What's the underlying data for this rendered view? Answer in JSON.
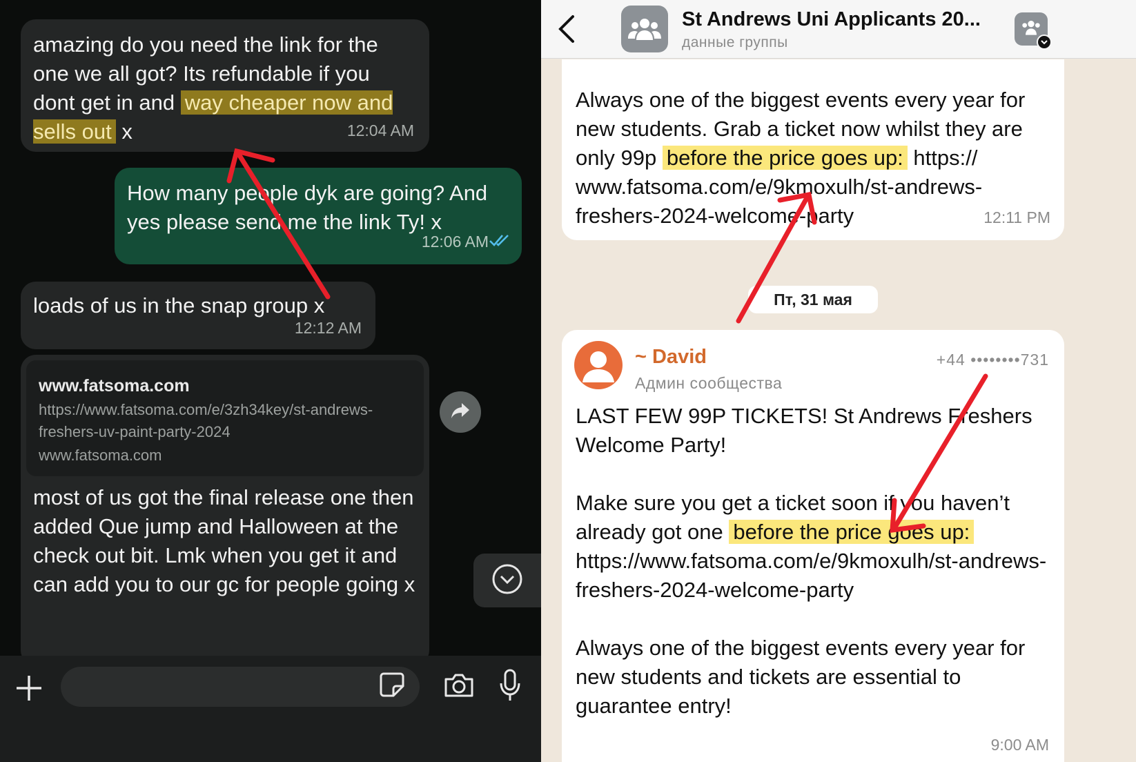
{
  "left": {
    "messages": [
      {
        "pre": "amazing do you need the link for the one we all got? Its refundable if you dont get in and",
        "highlight": "way cheaper now and sells out",
        "post": "x",
        "time": "12:04 AM"
      },
      {
        "text": "How many people dyk are going? And yes please send me the link Ty! x",
        "time": "12:06 AM"
      },
      {
        "text": "loads of us in the snap group x",
        "time": "12:12 AM"
      },
      {
        "link_site": "www.fatsoma.com",
        "link_url": "https://www.fatsoma.com/e/3zh34key/st-andrews-freshers-uv-paint-party-2024",
        "link_domain": "www.fatsoma.com",
        "text": "most of us got the final release one then added Que jump and Halloween at the check out bit. Lmk when you get it and can add you to our gc for people going x"
      }
    ],
    "icons": [
      "forward-icon",
      "scroll-down-icon",
      "plus-icon",
      "sticker-icon",
      "camera-icon",
      "microphone-icon",
      "double-check-icon"
    ]
  },
  "right": {
    "header": {
      "title": "St Andrews Uni Applicants 20...",
      "subtitle": "данные группы"
    },
    "message1": {
      "pre": "Always one of the biggest events every year for new students. Grab a ticket now whilst they are only 99p",
      "highlight": "before the price goes up:",
      "post": "https:// www.fatsoma.com/e/9kmoxulh/st-andrews-freshers-2024-welcome-party",
      "time": "12:11 PM"
    },
    "date_chip": "Пт, 31 мая",
    "message2": {
      "sender": "~ David",
      "role": "Админ сообщества",
      "phone": "+44 ••••••••731",
      "line1": "LAST FEW 99P TICKETS! St Andrews Freshers Welcome Party!",
      "pre": "Make sure you get a ticket soon if you haven’t already got one",
      "highlight": "before the price goes up:",
      "link": "https://www.fatsoma.com/e/9kmoxulh/st-andrews-freshers-2024-welcome-party",
      "line3": "Always one of the biggest events every year for new students and tickets are essential to guarantee entry!",
      "time": "9:00 AM"
    }
  },
  "colors": {
    "dark_bg": "#0b0d0c",
    "incoming_bubble": "#242626",
    "outgoing_bubble": "#144d37",
    "light_bg": "#efe7dc",
    "highlight_dark": "#8f7a1e",
    "highlight_light": "#fbe77c",
    "arrow": "#e8202a",
    "sender_name": "#d2692c"
  }
}
